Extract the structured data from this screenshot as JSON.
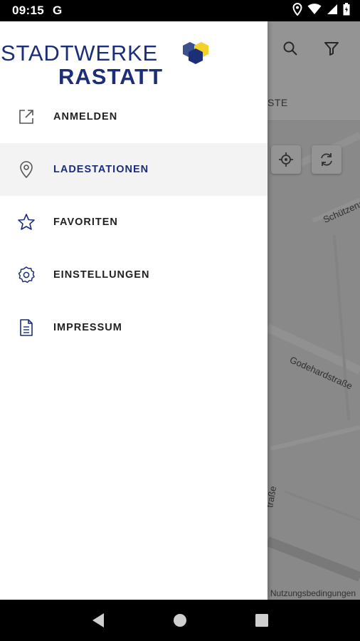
{
  "status_bar": {
    "time": "09:15",
    "g_label": "G",
    "icons": [
      "location-icon",
      "wifi-icon",
      "signal-icon",
      "battery-icon"
    ]
  },
  "brand": {
    "line1": "STADTWERKE",
    "line2": "RASTATT",
    "primary_color": "#1c2e78",
    "accent_color": "#f2d12a"
  },
  "drawer": {
    "items": [
      {
        "label": "ANMELDEN",
        "icon": "external-link-icon",
        "active": false
      },
      {
        "label": "LADESTATIONEN",
        "icon": "map-pin-icon",
        "active": true
      },
      {
        "label": "FAVORITEN",
        "icon": "star-icon",
        "active": false
      },
      {
        "label": "EINSTELLUNGEN",
        "icon": "gear-icon",
        "active": false
      },
      {
        "label": "IMPRESSUM",
        "icon": "document-icon",
        "active": false
      }
    ]
  },
  "background_app": {
    "toolbar_icons": [
      "search-icon",
      "filter-icon"
    ],
    "tab_partial": "STE",
    "map_buttons": [
      "my-location-icon",
      "refresh-icon"
    ],
    "street_labels": [
      "Schützenall",
      "Godehardstraße",
      "traße"
    ],
    "terms": "Nutzungsbedingungen"
  },
  "nav_bar": {
    "buttons": [
      "back-icon",
      "home-icon",
      "recents-icon"
    ]
  }
}
